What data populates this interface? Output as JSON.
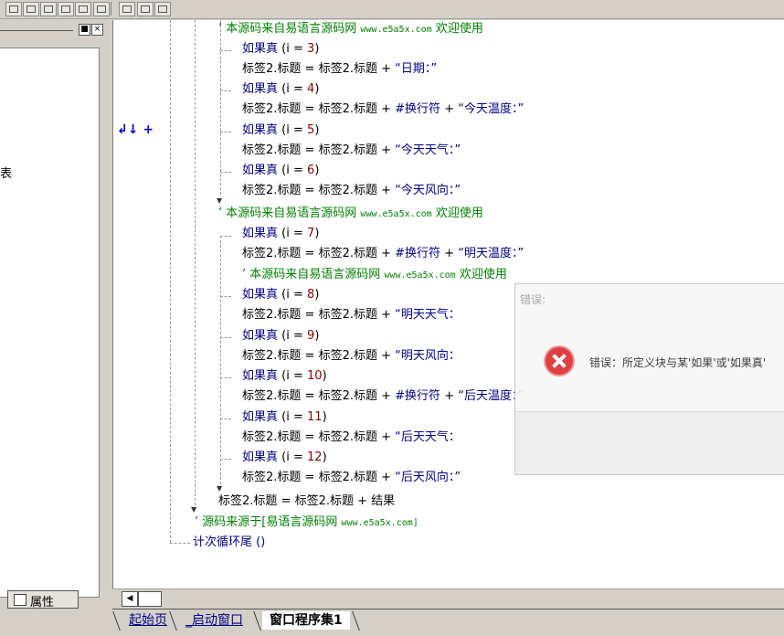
{
  "toolbar": {
    "icons": [
      "align-left-icon",
      "align-top-icon",
      "align-bottom-icon",
      "align-right-icon",
      "same-width-icon",
      "same-height-icon",
      "h-spacing-icon",
      "v-spacing-icon",
      "center-icon"
    ]
  },
  "left_panel": {
    "close_label": "×",
    "min_label": "■",
    "list_item": "表",
    "props_tab": "属性"
  },
  "gutter": {
    "marker": "↲↓ +"
  },
  "code": {
    "l1_comment": "’ 本源码来自易语言源码网",
    "url": "www.e5a5x.com",
    "welcome": "欢迎使用",
    "if_kw": "如果真",
    "i": "i",
    "eq": "=",
    "plus": "+",
    "lbl": "标签2.标题",
    "n3": "3",
    "n4": "4",
    "n5": "5",
    "n6": "6",
    "n7": "7",
    "n8": "8",
    "n9": "9",
    "n10": "10",
    "n11": "11",
    "n12": "12",
    "s_date": "“日期：”",
    "newline": "#换行符",
    "s_today_temp": "“今天温度：”",
    "s_today_weather": "“今天天气：”",
    "s_today_wind": "“今天风向：”",
    "plain_comment": "本源码来自易语言源码网",
    "s_tom_temp": "“明天温度：”",
    "s_tom_weather": "“明天天气：",
    "s_tom_wind": "“明天风向：",
    "s_after_temp": "“后天温度：”",
    "s_after_weather": "“后天天气：",
    "s_after_wind": "“后天风向：”",
    "result": "结果",
    "src_comment": "’ 源码来源于[易语言源码网",
    "src_url": "www.e5a5x.com]",
    "loop_end": "计次循环尾 ()"
  },
  "scrollbar": {
    "left_arrow": "◀"
  },
  "tabs": [
    {
      "label": "起始页"
    },
    {
      "label": "_启动窗口"
    },
    {
      "label": "窗口程序集1"
    }
  ],
  "error": {
    "title": "错误:",
    "message": "错误：所定义块与某'如果'或'如果真'"
  }
}
